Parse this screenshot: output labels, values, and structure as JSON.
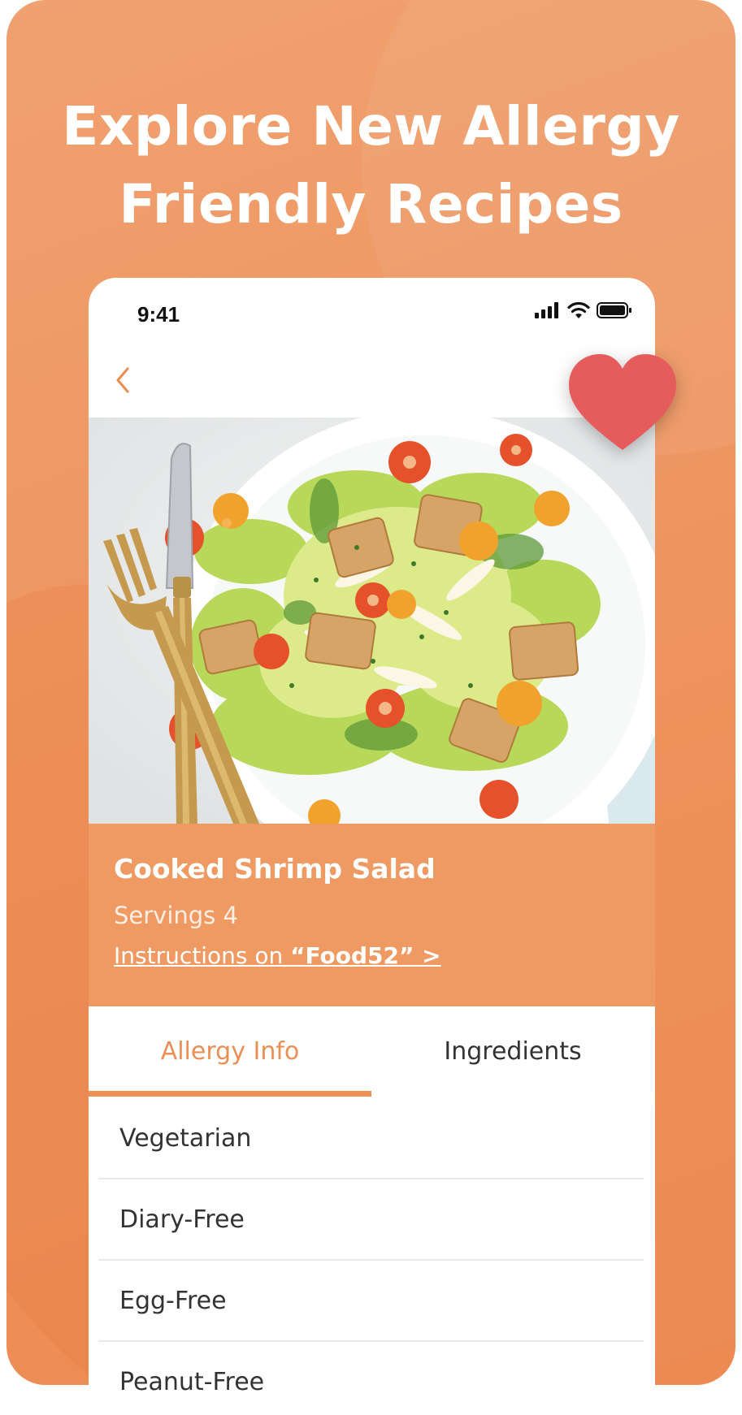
{
  "headline": {
    "line1": "Explore New Allergy",
    "line2": "Friendly Recipes"
  },
  "phone": {
    "status_bar": {
      "time": "9:41"
    },
    "recipe": {
      "title": "Cooked Shrimp Salad",
      "servings": "Servings 4",
      "instructions_prefix": "Instructions on ",
      "instructions_source": "“Food52” >"
    },
    "tabs": [
      {
        "label": "Allergy Info",
        "active": true
      },
      {
        "label": "Ingredients",
        "active": false
      }
    ],
    "allergy_list": [
      "Vegetarian",
      "Diary-Free",
      "Egg-Free",
      "Peanut-Free"
    ]
  },
  "colors": {
    "brand_orange": "#ee9a62",
    "heart_red": "#e65c5c",
    "tab_active": "#ea8f55"
  },
  "icons": [
    "chevron-left-icon",
    "heart-icon",
    "signal-icon",
    "wifi-icon",
    "battery-icon"
  ]
}
